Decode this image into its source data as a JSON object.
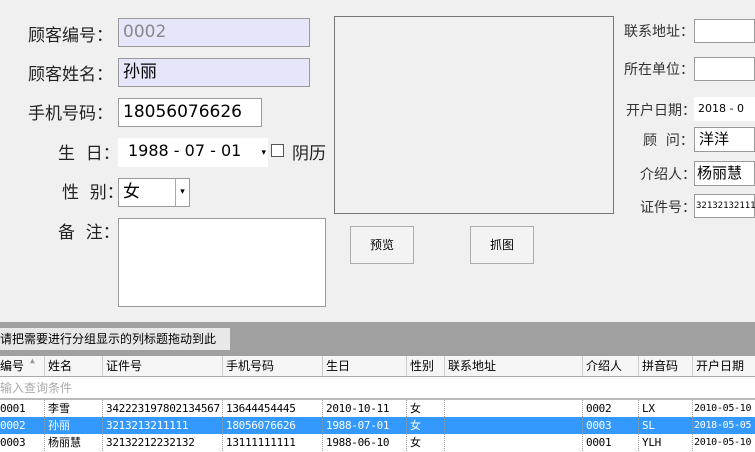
{
  "form": {
    "customer_id_label": "顾客编号：",
    "customer_id": "0002",
    "customer_name_label": "顾客姓名：",
    "customer_name": "孙丽",
    "phone_label": "手机号码：",
    "phone": "18056076626",
    "birthday_label": "生  日：",
    "birthday": "1988 - 07 - 01",
    "lunar_label": "阴历",
    "gender_label": "性  别：",
    "gender": "女",
    "notes_label": "备  注：",
    "notes": "",
    "preview_button": "预览",
    "capture_button": "抓图",
    "address_label": "联系地址：",
    "address": "",
    "company_label": "所在单位：",
    "company": "",
    "open_date_label": "开户日期：",
    "open_date": "2018 - 0",
    "consultant_label": "顾  问：",
    "consultant": "洋洋",
    "referrer_label": "介绍人：",
    "referrer": "杨丽慧",
    "id_card_label": "证件号：",
    "id_card": "32132132111"
  },
  "grid": {
    "group_hint": "请把需要进行分组显示的列标题拖动到此",
    "filter_placeholder": "输入查询条件",
    "columns": [
      "编号",
      "姓名",
      "证件号",
      "手机号码",
      "生日",
      "性别",
      "联系地址",
      "介绍人",
      "拼音码",
      "开户日期"
    ],
    "rows": [
      [
        "0001",
        "李雪",
        "342223197802134567",
        "13644454445",
        "2010-10-11",
        "女",
        "",
        "0002",
        "LX",
        "2010-05-10"
      ],
      [
        "0002",
        "孙丽",
        "3213213211111",
        "18056076626",
        "1988-07-01",
        "女",
        "",
        "0003",
        "SL",
        "2018-05-05"
      ],
      [
        "0003",
        "杨丽慧",
        "32132212232132",
        "13111111111",
        "1988-06-10",
        "女",
        "",
        "0001",
        "YLH",
        "2010-05-10"
      ]
    ],
    "selected_row": 1
  }
}
